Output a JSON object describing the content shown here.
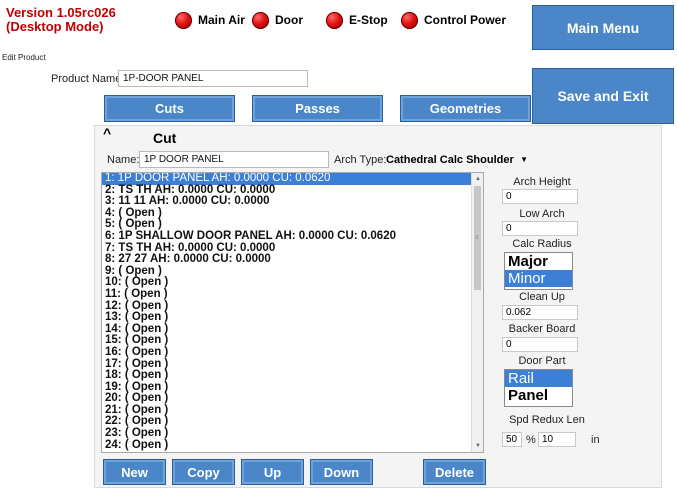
{
  "header": {
    "version": "Version 1.05rc026",
    "mode": "(Desktop Mode)",
    "indicators": [
      {
        "label": "Main Air"
      },
      {
        "label": "Door"
      },
      {
        "label": "E-Stop"
      },
      {
        "label": "Control Power"
      }
    ],
    "main_menu_label": "Main Menu",
    "save_exit_label": "Save and Exit"
  },
  "edit_product": {
    "section_label": "Edit Product",
    "product_name_label": "Product Name:",
    "product_name_value": "1P-DOOR PANEL",
    "tabs": [
      "Cuts",
      "Passes",
      "Geometries"
    ]
  },
  "cut": {
    "collapse_glyph": "^",
    "title": "Cut",
    "name_label": "Name:",
    "name_value": "1P DOOR PANEL",
    "arch_type_label": "Arch Type:",
    "arch_type_value": "Cathedral Calc Shoulder",
    "items": [
      "1:  1P DOOR PANEL AH: 0.0000 CU: 0.0620",
      "2:  TS     TH AH: 0.0000 CU: 0.0000",
      "3:  11     11 AH: 0.0000 CU: 0.0000",
      "4:  ( Open )",
      "5:  ( Open )",
      "6:  1P SHALLOW DOOR PANEL AH: 0.0000 CU: 0.0620",
      "7:  TS     TH AH: 0.0000 CU: 0.0000",
      "8:  27     27 AH: 0.0000 CU: 0.0000",
      "9:  ( Open )",
      "10:  ( Open )",
      "11:  ( Open )",
      "12:  ( Open )",
      "13:  ( Open )",
      "14:  ( Open )",
      "15:  ( Open )",
      "16:  ( Open )",
      "17:  ( Open )",
      "18:  ( Open )",
      "19:  ( Open )",
      "20:  ( Open )",
      "21:  ( Open )",
      "22:  ( Open )",
      "23:  ( Open )",
      "24:  ( Open )"
    ],
    "selected_index": 0,
    "right": {
      "arch_height_label": "Arch Height",
      "arch_height_value": "0",
      "low_arch_height_label": "Low Arch Height",
      "low_arch_height_value": "0",
      "calc_radius_label": "Calc Radius",
      "calc_radius_options": [
        "Major",
        "Minor"
      ],
      "calc_radius_selected": 1,
      "clean_up_label": "Clean Up",
      "clean_up_value": "0.062",
      "backer_board_label": "Backer Board",
      "backer_board_value": "0",
      "door_part_label": "Door Part",
      "door_part_options": [
        "Rail",
        "Panel"
      ],
      "door_part_selected": 0,
      "spd_redux_label": "Spd Redux Len",
      "spd_redux_pct": "50",
      "spd_redux_pct_sign": "%",
      "spd_redux_len": "10",
      "spd_redux_unit": "in"
    },
    "buttons": [
      "New",
      "Copy",
      "Up",
      "Down",
      "Delete"
    ]
  },
  "colors": {
    "button_blue": "#4a86c8",
    "selection_blue": "#3b7fd6",
    "version_red": "#c00000"
  }
}
